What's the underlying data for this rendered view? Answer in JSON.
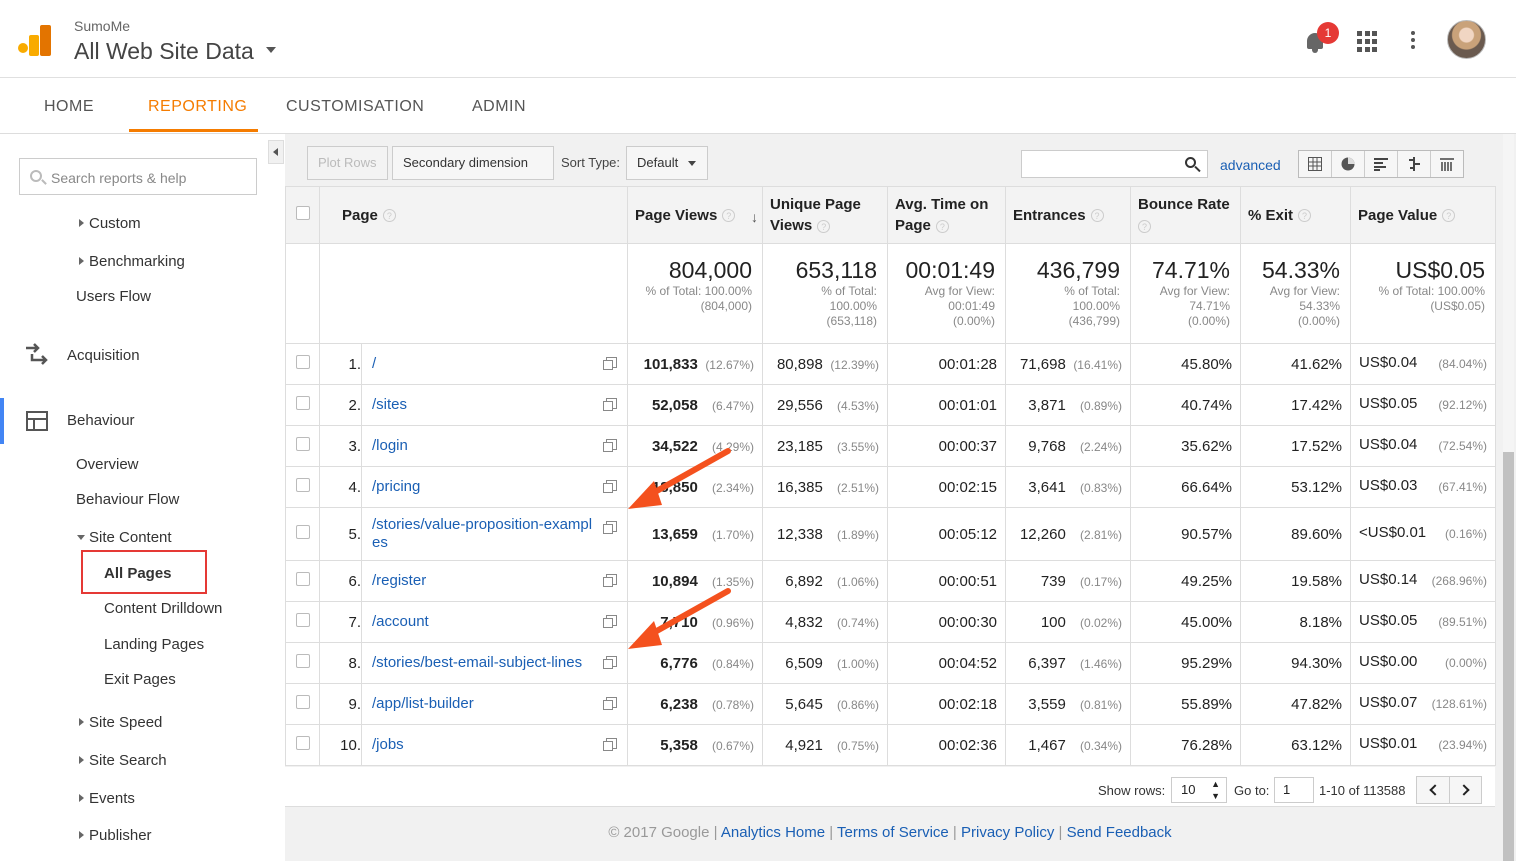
{
  "header": {
    "account_small": "SumoMe",
    "account_big": "All Web Site Data",
    "notification_count": "1"
  },
  "nav": {
    "home": "HOME",
    "reporting": "REPORTING",
    "customisation": "CUSTOMISATION",
    "admin": "ADMIN"
  },
  "sidebar": {
    "search_placeholder": "Search reports & help",
    "custom": "Custom",
    "benchmarking": "Benchmarking",
    "users_flow": "Users Flow",
    "acquisition": "Acquisition",
    "behaviour": "Behaviour",
    "overview": "Overview",
    "behaviour_flow": "Behaviour Flow",
    "site_content": "Site Content",
    "all_pages": "All Pages",
    "content_drilldown": "Content Drilldown",
    "landing_pages": "Landing Pages",
    "exit_pages": "Exit Pages",
    "site_speed": "Site Speed",
    "site_search": "Site Search",
    "events": "Events",
    "publisher": "Publisher"
  },
  "toolbar": {
    "plot_rows": "Plot Rows",
    "secondary_dimension": "Secondary dimension",
    "sort_type_label": "Sort Type:",
    "sort_type_value": "Default",
    "advanced": "advanced"
  },
  "table": {
    "headers": {
      "page": "Page",
      "page_views": "Page Views",
      "unique_l1": "Unique Page",
      "unique_l2": "Views",
      "avg_l1": "Avg. Time on",
      "avg_l2": "Page",
      "entrances": "Entrances",
      "bounce": "Bounce Rate",
      "exit": "% Exit",
      "value": "Page Value"
    },
    "totals": {
      "pv": "804,000",
      "pv_s1": "% of Total: 100.00%",
      "pv_s2": "(804,000)",
      "up": "653,118",
      "up_s1": "% of Total:",
      "up_s2": "100.00%",
      "up_s3": "(653,118)",
      "at": "00:01:49",
      "at_s1": "Avg for View:",
      "at_s2": "00:01:49",
      "at_s3": "(0.00%)",
      "en": "436,799",
      "en_s1": "% of Total:",
      "en_s2": "100.00%",
      "en_s3": "(436,799)",
      "br": "74.71%",
      "br_s1": "Avg for View:",
      "br_s2": "74.71%",
      "br_s3": "(0.00%)",
      "ex": "54.33%",
      "ex_s1": "Avg for View:",
      "ex_s2": "54.33%",
      "ex_s3": "(0.00%)",
      "va": "US$0.05",
      "va_s1": "% of Total: 100.00%",
      "va_s2": "(US$0.05)"
    },
    "rows": [
      {
        "n": "1.",
        "page": "/",
        "pv": "101,833",
        "pvp": "(12.67%)",
        "up": "80,898",
        "upp": "(12.39%)",
        "at": "00:01:28",
        "en": "71,698",
        "enp": "(16.41%)",
        "br": "45.80%",
        "ex": "41.62%",
        "va": "US$0.04",
        "vap": "(84.04%)"
      },
      {
        "n": "2.",
        "page": "/sites",
        "pv": "52,058",
        "pvp": "(6.47%)",
        "up": "29,556",
        "upp": "(4.53%)",
        "at": "00:01:01",
        "en": "3,871",
        "enp": "(0.89%)",
        "br": "40.74%",
        "ex": "17.42%",
        "va": "US$0.05",
        "vap": "(92.12%)"
      },
      {
        "n": "3.",
        "page": "/login",
        "pv": "34,522",
        "pvp": "(4.29%)",
        "up": "23,185",
        "upp": "(3.55%)",
        "at": "00:00:37",
        "en": "9,768",
        "enp": "(2.24%)",
        "br": "35.62%",
        "ex": "17.52%",
        "va": "US$0.04",
        "vap": "(72.54%)"
      },
      {
        "n": "4.",
        "page": "/pricing",
        "pv": "18,850",
        "pvp": "(2.34%)",
        "up": "16,385",
        "upp": "(2.51%)",
        "at": "00:02:15",
        "en": "3,641",
        "enp": "(0.83%)",
        "br": "66.64%",
        "ex": "53.12%",
        "va": "US$0.03",
        "vap": "(67.41%)"
      },
      {
        "n": "5.",
        "page": "/stories/value-proposition-examples",
        "pv": "13,659",
        "pvp": "(1.70%)",
        "up": "12,338",
        "upp": "(1.89%)",
        "at": "00:05:12",
        "en": "12,260",
        "enp": "(2.81%)",
        "br": "90.57%",
        "ex": "89.60%",
        "va": "<US$0.01",
        "vap": "(0.16%)"
      },
      {
        "n": "6.",
        "page": "/register",
        "pv": "10,894",
        "pvp": "(1.35%)",
        "up": "6,892",
        "upp": "(1.06%)",
        "at": "00:00:51",
        "en": "739",
        "enp": "(0.17%)",
        "br": "49.25%",
        "ex": "19.58%",
        "va": "US$0.14",
        "vap": "(268.96%)"
      },
      {
        "n": "7.",
        "page": "/account",
        "pv": "7,710",
        "pvp": "(0.96%)",
        "up": "4,832",
        "upp": "(0.74%)",
        "at": "00:00:30",
        "en": "100",
        "enp": "(0.02%)",
        "br": "45.00%",
        "ex": "8.18%",
        "va": "US$0.05",
        "vap": "(89.51%)"
      },
      {
        "n": "8.",
        "page": "/stories/best-email-subject-lines",
        "pv": "6,776",
        "pvp": "(0.84%)",
        "up": "6,509",
        "upp": "(1.00%)",
        "at": "00:04:52",
        "en": "6,397",
        "enp": "(1.46%)",
        "br": "95.29%",
        "ex": "94.30%",
        "va": "US$0.00",
        "vap": "(0.00%)"
      },
      {
        "n": "9.",
        "page": "/app/list-builder",
        "pv": "6,238",
        "pvp": "(0.78%)",
        "up": "5,645",
        "upp": "(0.86%)",
        "at": "00:02:18",
        "en": "3,559",
        "enp": "(0.81%)",
        "br": "55.89%",
        "ex": "47.82%",
        "va": "US$0.07",
        "vap": "(128.61%)"
      },
      {
        "n": "10.",
        "page": "/jobs",
        "pv": "5,358",
        "pvp": "(0.67%)",
        "up": "4,921",
        "upp": "(0.75%)",
        "at": "00:02:36",
        "en": "1,467",
        "enp": "(0.34%)",
        "br": "76.28%",
        "ex": "63.12%",
        "va": "US$0.01",
        "vap": "(23.94%)"
      }
    ]
  },
  "pager": {
    "show_rows_label": "Show rows:",
    "show_rows_value": "10",
    "goto_label": "Go to:",
    "goto_value": "1",
    "range": "1-10 of 113588"
  },
  "footer": {
    "copyright": "© 2017 Google",
    "analytics_home": "Analytics Home",
    "terms": "Terms of Service",
    "privacy": "Privacy Policy",
    "feedback": "Send Feedback"
  },
  "colors": {
    "accent": "#f57c00",
    "link": "#1a5fb4",
    "highlight_box": "#e53935",
    "annotation_arrow": "#f4511e"
  }
}
